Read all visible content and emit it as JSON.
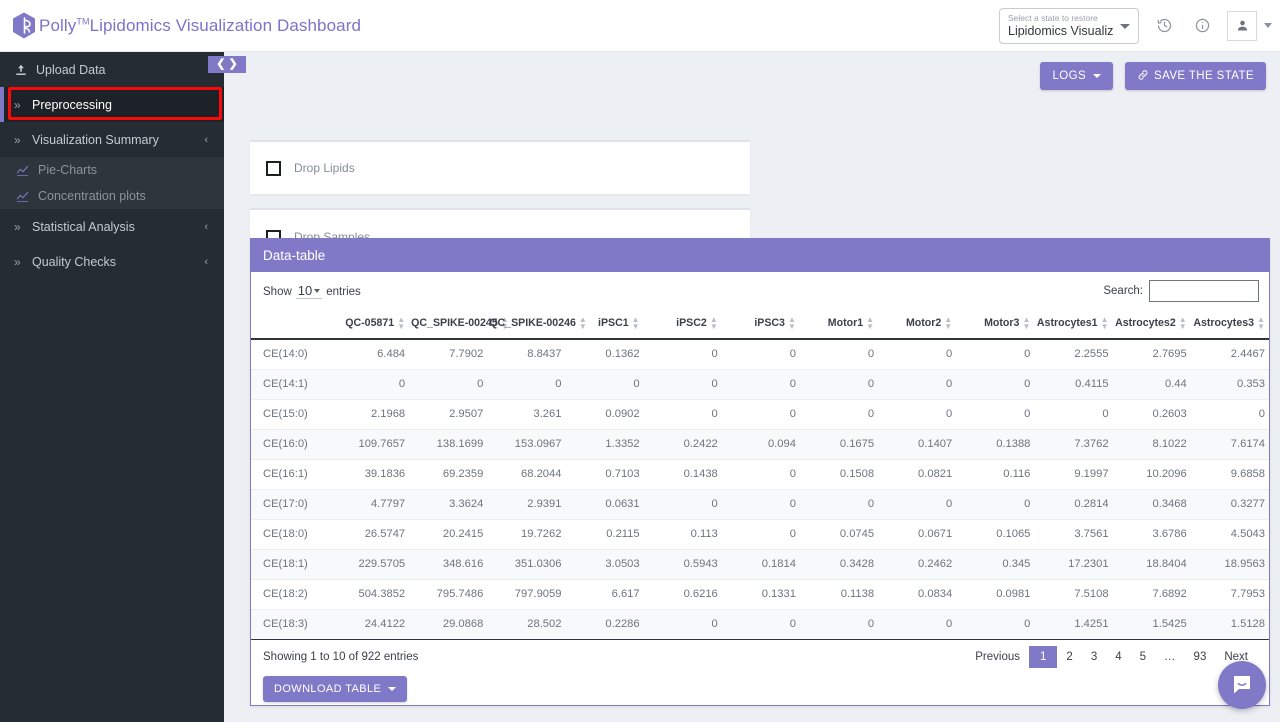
{
  "header": {
    "brand_name": "Polly",
    "brand_tm": "TM",
    "brand_title": "Lipidomics Visualization Dashboard",
    "state_select": {
      "label": "Select a state to restore",
      "value": "Lipidomics Visualiza...",
      "caret_icon": "chevron-down-icon"
    },
    "history_icon": "history-icon",
    "info_icon": "info-icon",
    "avatar_icon": "user-icon",
    "avatar_caret_icon": "chevron-down-icon"
  },
  "sidebar": {
    "collapse_prev_icon": "chevron-left-icon",
    "collapse_next_icon": "chevron-right-icon",
    "items": [
      {
        "label": "Upload Data",
        "icon": "upload-icon",
        "active": false,
        "has_caret": false
      },
      {
        "label": "Preprocessing",
        "icon": "double-chevron-icon",
        "active": true,
        "has_caret": false
      },
      {
        "label": "Visualization Summary",
        "icon": "double-chevron-icon",
        "active": false,
        "has_caret": true
      },
      {
        "label": "Statistical Analysis",
        "icon": "double-chevron-icon",
        "active": false,
        "has_caret": true
      },
      {
        "label": "Quality Checks",
        "icon": "double-chevron-icon",
        "active": false,
        "has_caret": true
      }
    ],
    "sub_items": [
      {
        "label": "Pie-Charts",
        "icon": "chart-line-icon"
      },
      {
        "label": "Concentration plots",
        "icon": "chart-line-icon"
      }
    ]
  },
  "toolbar": {
    "logs_label": "LOGS",
    "save_label": "SAVE THE STATE",
    "save_icon": "link-icon"
  },
  "cards": [
    {
      "label": "Drop Lipids",
      "checked": false
    },
    {
      "label": "Drop Samples",
      "checked": false
    }
  ],
  "datatable": {
    "title": "Data-table",
    "show_prefix": "Show",
    "page_length": "10",
    "show_suffix": "entries",
    "search_label": "Search:",
    "search_value": "",
    "search_placeholder": "",
    "columns": [
      "",
      "QC-05871",
      "QC_SPIKE-00245",
      "QC_SPIKE-00246",
      "iPSC1",
      "iPSC2",
      "iPSC3",
      "Motor1",
      "Motor2",
      "Motor3",
      "Astrocytes1",
      "Astrocytes2",
      "Astrocytes3"
    ],
    "rows": [
      [
        "CE(14:0)",
        "6.484",
        "7.7902",
        "8.8437",
        "0.1362",
        "0",
        "0",
        "0",
        "0",
        "0",
        "2.2555",
        "2.7695",
        "2.4467"
      ],
      [
        "CE(14:1)",
        "0",
        "0",
        "0",
        "0",
        "0",
        "0",
        "0",
        "0",
        "0",
        "0.4115",
        "0.44",
        "0.353"
      ],
      [
        "CE(15:0)",
        "2.1968",
        "2.9507",
        "3.261",
        "0.0902",
        "0",
        "0",
        "0",
        "0",
        "0",
        "0",
        "0.2603",
        "0"
      ],
      [
        "CE(16:0)",
        "109.7657",
        "138.1699",
        "153.0967",
        "1.3352",
        "0.2422",
        "0.094",
        "0.1675",
        "0.1407",
        "0.1388",
        "7.3762",
        "8.1022",
        "7.6174"
      ],
      [
        "CE(16:1)",
        "39.1836",
        "69.2359",
        "68.2044",
        "0.7103",
        "0.1438",
        "0",
        "0.1508",
        "0.0821",
        "0.116",
        "9.1997",
        "10.2096",
        "9.6858"
      ],
      [
        "CE(17:0)",
        "4.7797",
        "3.3624",
        "2.9391",
        "0.0631",
        "0",
        "0",
        "0",
        "0",
        "0",
        "0.2814",
        "0.3468",
        "0.3277"
      ],
      [
        "CE(18:0)",
        "26.5747",
        "20.2415",
        "19.7262",
        "0.2115",
        "0.113",
        "0",
        "0.0745",
        "0.0671",
        "0.1065",
        "3.7561",
        "3.6786",
        "4.5043"
      ],
      [
        "CE(18:1)",
        "229.5705",
        "348.616",
        "351.0306",
        "3.0503",
        "0.5943",
        "0.1814",
        "0.3428",
        "0.2462",
        "0.345",
        "17.2301",
        "18.8404",
        "18.9563"
      ],
      [
        "CE(18:2)",
        "504.3852",
        "795.7486",
        "797.9059",
        "6.617",
        "0.6216",
        "0.1331",
        "0.1138",
        "0.0834",
        "0.0981",
        "7.5108",
        "7.6892",
        "7.7953"
      ],
      [
        "CE(18:3)",
        "24.4122",
        "29.0868",
        "28.502",
        "0.2286",
        "0",
        "0",
        "0",
        "0",
        "0",
        "1.4251",
        "1.5425",
        "1.5128"
      ]
    ],
    "info": "Showing 1 to 10 of 922 entries",
    "pagination": {
      "previous": "Previous",
      "pages": [
        "1",
        "2",
        "3",
        "4",
        "5",
        "…",
        "93"
      ],
      "current": "1",
      "next": "Next"
    },
    "download_label": "DOWNLOAD TABLE"
  },
  "chat": {
    "icon": "chat-bubble-icon"
  },
  "colors": {
    "accent": "#8079c8",
    "sidebar_bg": "#252c33",
    "sidebar_active_bg": "#1d2228",
    "page_bg": "#eceff4",
    "highlight": "#fb0808"
  }
}
